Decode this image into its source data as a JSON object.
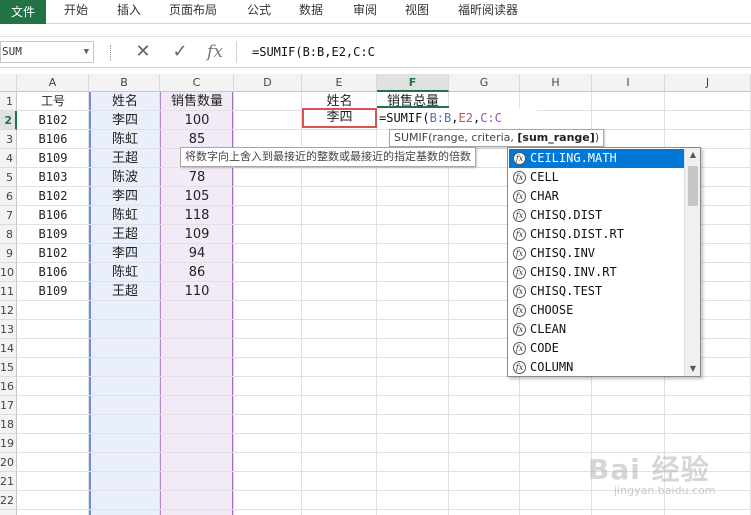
{
  "ribbon": {
    "file_tab": "文件",
    "tabs": [
      "开始",
      "插入",
      "页面布局",
      "公式",
      "数据",
      "审阅",
      "视图",
      "福昕阅读器"
    ]
  },
  "formula_bar": {
    "name_box": "SUM",
    "cancel_icon": "close-icon",
    "enter_icon": "check-icon",
    "fx_label": "fx",
    "formula": "=SUMIF(B:B,E2,C:C"
  },
  "grid": {
    "columns": [
      "A",
      "B",
      "C",
      "D",
      "E",
      "F",
      "G",
      "H",
      "I",
      "J"
    ],
    "active_column": "F",
    "rows": [
      "1",
      "2",
      "3",
      "4",
      "5",
      "6",
      "7",
      "8",
      "9",
      "10",
      "11",
      "12",
      "13",
      "14",
      "15",
      "16",
      "17",
      "18",
      "19",
      "20",
      "21",
      "22",
      "23"
    ],
    "active_row": "2",
    "headers": {
      "A": "工号",
      "B": "姓名",
      "C": "销售数量",
      "E": "姓名",
      "F": "销售总量"
    },
    "data": [
      {
        "id": "B102",
        "name": "李四",
        "qty": "100"
      },
      {
        "id": "B106",
        "name": "陈虹",
        "qty": "85"
      },
      {
        "id": "B109",
        "name": "王超",
        "qty": ""
      },
      {
        "id": "B103",
        "name": "陈波",
        "qty": "78"
      },
      {
        "id": "B102",
        "name": "李四",
        "qty": "105"
      },
      {
        "id": "B106",
        "name": "陈虹",
        "qty": "118"
      },
      {
        "id": "B109",
        "name": "王超",
        "qty": "109"
      },
      {
        "id": "B102",
        "name": "李四",
        "qty": "94"
      },
      {
        "id": "B106",
        "name": "陈虹",
        "qty": "86"
      },
      {
        "id": "B109",
        "name": "王超",
        "qty": "110"
      }
    ],
    "e2": "李四",
    "f2_formula": {
      "prefix": "=SUMIF(",
      "ref1": "B:B",
      "sep1": ",",
      "ref2": "E2",
      "sep2": ",",
      "ref3": "C:C"
    }
  },
  "tooltips": {
    "args_prefix": "SUMIF(range, criteria, ",
    "args_bold": "[sum_range]",
    "args_suffix": ")",
    "description": "将数字向上舍入到最接近的整数或最接近的指定基数的倍数"
  },
  "autocomplete": {
    "selected": "CEILING.MATH",
    "items": [
      "CEILING.MATH",
      "CELL",
      "CHAR",
      "CHISQ.DIST",
      "CHISQ.DIST.RT",
      "CHISQ.INV",
      "CHISQ.INV.RT",
      "CHISQ.TEST",
      "CHOOSE",
      "CLEAN",
      "CODE",
      "COLUMN"
    ],
    "item_icon": "function-icon"
  },
  "watermark": {
    "text": "Bai 经验",
    "sub": "jingyan.baidu.com"
  }
}
